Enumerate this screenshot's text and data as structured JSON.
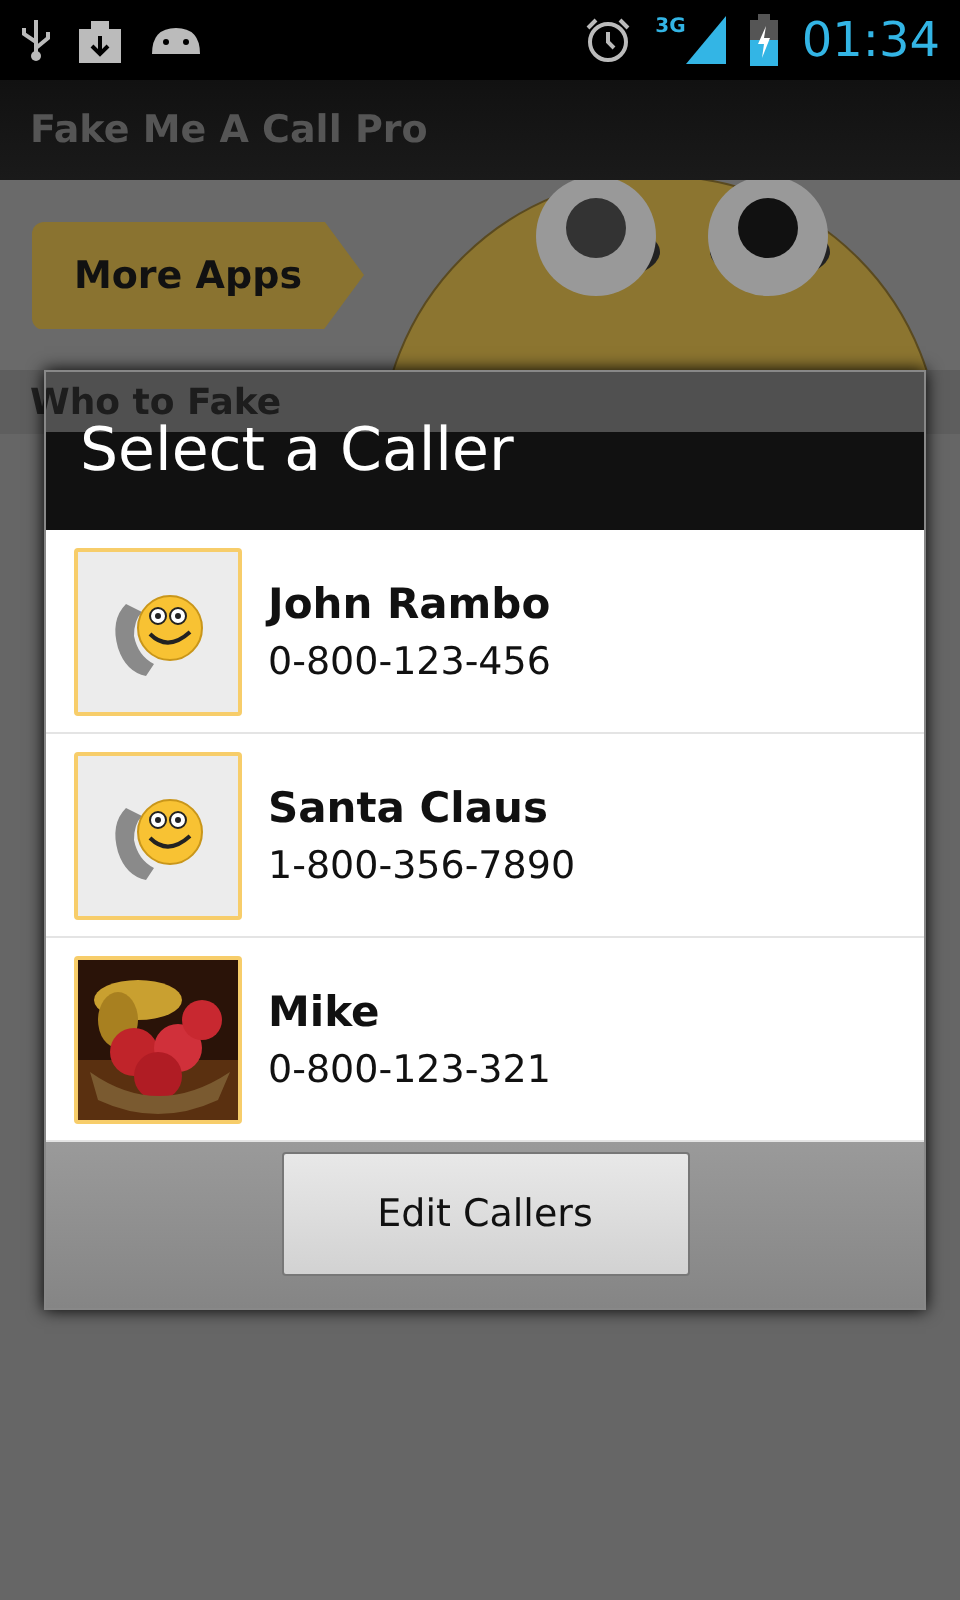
{
  "status_bar": {
    "time": "01:34",
    "network": "3G"
  },
  "app_title": "Fake Me A Call Pro",
  "banner": {
    "button": "More Apps"
  },
  "section_header": "Who to Fake",
  "dialog": {
    "title": "Select a Caller",
    "callers": [
      {
        "name": "John Rambo",
        "number": "0-800-123-456",
        "kind": "icon"
      },
      {
        "name": "Santa Claus",
        "number": "1-800-356-7890",
        "kind": "icon"
      },
      {
        "name": "Mike",
        "number": "0-800-123-321",
        "kind": "picture"
      }
    ],
    "button": "Edit Callers"
  }
}
